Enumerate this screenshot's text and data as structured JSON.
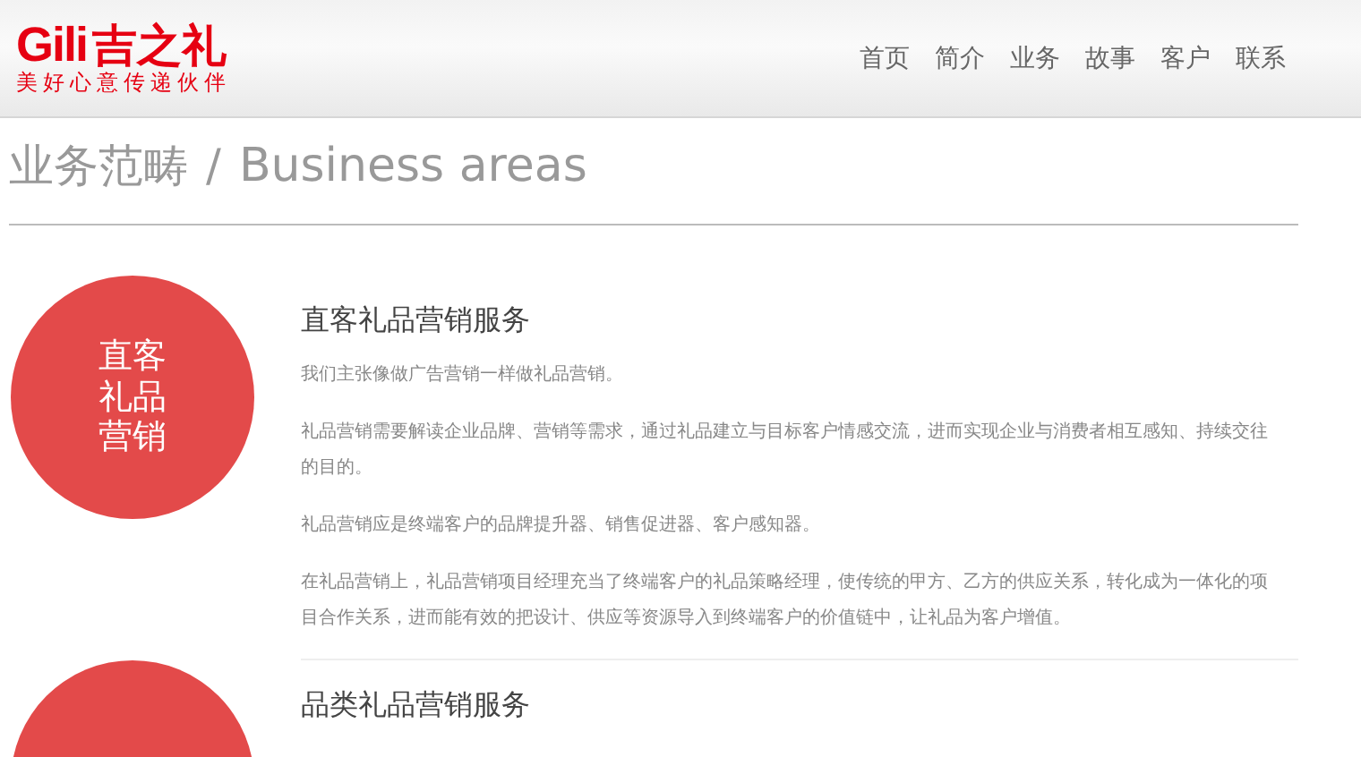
{
  "header": {
    "logo": {
      "brand": "Gili",
      "name": "吉之礼",
      "tagline": "美好心意传递伙伴"
    },
    "nav": [
      "首页",
      "简介",
      "业务",
      "故事",
      "客户",
      "联系"
    ]
  },
  "page_title": {
    "chinese": "业务范畴",
    "separator": "/",
    "english": "Business areas"
  },
  "services": [
    {
      "badge": "直客礼品营销",
      "title": "直客礼品营销服务",
      "paragraphs": [
        "我们主张像做广告营销一样做礼品营销。",
        "礼品营销需要解读企业品牌、营销等需求，通过礼品建立与目标客户情感交流，进而实现企业与消费者相互感知、持续交往的目的。",
        "礼品营销应是终端客户的品牌提升器、销售促进器、客户感知器。",
        "在礼品营销上，礼品营销项目经理充当了终端客户的礼品策略经理，使传统的甲方、乙方的供应关系，转化成为一体化的项目合作关系，进而能有效的把设计、供应等资源导入到终端客户的价值链中，让礼品为客户增值。"
      ]
    },
    {
      "title": "品类礼品营销服务"
    }
  ]
}
